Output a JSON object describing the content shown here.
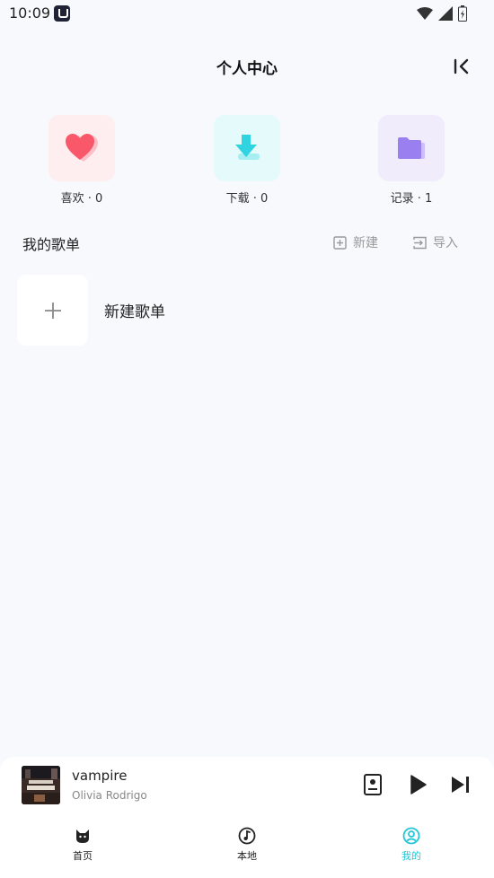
{
  "status_bar": {
    "time": "10:09"
  },
  "header": {
    "title": "个人中心"
  },
  "quick_cards": [
    {
      "label": "喜欢 · 0",
      "icon": "heart-icon",
      "color": "#f9576a"
    },
    {
      "label": "下载 · 0",
      "icon": "download-icon",
      "color": "#2fd4e0"
    },
    {
      "label": "记录 · 1",
      "icon": "folder-icon",
      "color": "#9a7ff0"
    }
  ],
  "playlists": {
    "title": "我的歌单",
    "new_label": "新建",
    "import_label": "导入",
    "create_label": "新建歌单"
  },
  "player": {
    "title": "vampire",
    "artist": "Olivia Rodrigo"
  },
  "nav": {
    "items": [
      {
        "label": "首页",
        "icon": "cat-icon"
      },
      {
        "label": "本地",
        "icon": "music-note-icon"
      },
      {
        "label": "我的",
        "icon": "user-circle-icon"
      }
    ],
    "active_color": "#22c6d6"
  }
}
